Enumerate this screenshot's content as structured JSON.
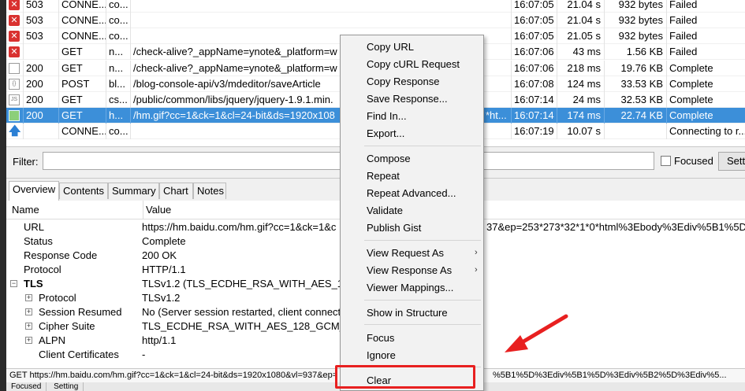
{
  "sessions": [
    {
      "icon": "error-icon",
      "result": "503",
      "protocol": "CONNE...",
      "host": "co...",
      "url": "",
      "time": "16:07:05",
      "duration": "21.04 s",
      "size": "932 bytes",
      "status": "Failed"
    },
    {
      "icon": "error-icon",
      "result": "503",
      "protocol": "CONNE...",
      "host": "co...",
      "url": "",
      "time": "16:07:05",
      "duration": "21.04 s",
      "size": "932 bytes",
      "status": "Failed"
    },
    {
      "icon": "error-icon",
      "result": "503",
      "protocol": "CONNE...",
      "host": "co...",
      "url": "",
      "time": "16:07:05",
      "duration": "21.05 s",
      "size": "932 bytes",
      "status": "Failed"
    },
    {
      "icon": "error-icon",
      "result": "",
      "protocol": "GET",
      "host": "n...",
      "url": "/check-alive?_appName=ynote&_platform=w",
      "time": "16:07:06",
      "duration": "43 ms",
      "size": "1.56 KB",
      "status": "Failed"
    },
    {
      "icon": "document-icon",
      "result": "200",
      "protocol": "GET",
      "host": "n...",
      "url": "/check-alive?_appName=ynote&_platform=w",
      "time": "16:07:06",
      "duration": "218 ms",
      "size": "19.76 KB",
      "status": "Complete"
    },
    {
      "icon": "json-icon",
      "result": "200",
      "protocol": "POST",
      "host": "bl...",
      "url": "/blog-console-api/v3/mdeditor/saveArticle",
      "time": "16:07:08",
      "duration": "124 ms",
      "size": "33.53 KB",
      "status": "Complete"
    },
    {
      "icon": "javascript-icon",
      "result": "200",
      "protocol": "GET",
      "host": "cs...",
      "url": "/public/common/libs/jquery/jquery-1.9.1.min.",
      "time": "16:07:14",
      "duration": "24 ms",
      "size": "32.53 KB",
      "status": "Complete"
    },
    {
      "icon": "image-icon",
      "result": "200",
      "protocol": "GET",
      "host": "h...",
      "url": "/hm.gif?cc=1&ck=1&cl=24-bit&ds=1920x108",
      "url_tail": "*ht...",
      "time": "16:07:14",
      "duration": "174 ms",
      "size": "22.74 KB",
      "status": "Complete",
      "selected": true
    },
    {
      "icon": "upload-arrow-icon",
      "result": "",
      "protocol": "CONNE...",
      "host": "co...",
      "url": "",
      "time": "16:07:19",
      "duration": "10.07 s",
      "size": "",
      "status": "Connecting to r..."
    }
  ],
  "filter": {
    "label": "Filter:",
    "value": "",
    "focused_label": "Focused",
    "settings_label": "Sett"
  },
  "inspector": {
    "tabs": [
      "Overview",
      "Contents",
      "Summary",
      "Chart",
      "Notes"
    ],
    "active_tab": "Overview",
    "col_name": "Name",
    "col_value": "Value",
    "properties": [
      {
        "name": "URL",
        "value": "https://hm.baidu.com/hm.gif?cc=1&ck=1&c",
        "value_tail": "37&ep=253*273*32*1*0*html%3Ebody%3Ediv%5B1%5D%"
      },
      {
        "name": "Status",
        "value": "Complete"
      },
      {
        "name": "Response Code",
        "value": "200 OK"
      },
      {
        "name": "Protocol",
        "value": "HTTP/1.1"
      },
      {
        "name": "TLS",
        "value": "TLSv1.2 (TLS_ECDHE_RSA_WITH_AES_128_GC",
        "group": true
      },
      {
        "name": "Protocol",
        "value": "TLSv1.2",
        "child": true
      },
      {
        "name": "Session Resumed",
        "value": "No (Server session restarted, client connect",
        "child": true
      },
      {
        "name": "Cipher Suite",
        "value": "TLS_ECDHE_RSA_WITH_AES_128_GCM_SHA2",
        "child": true
      },
      {
        "name": "ALPN",
        "value": "http/1.1",
        "child": true
      },
      {
        "name": "Client Certificates",
        "value": "-",
        "child": true,
        "leaf": true
      }
    ]
  },
  "statusbar": {
    "text": "GET https://hm.baidu.com/hm.gif?cc=1&ck=1&cl=24-bit&ds=1920x1080&vl=937&ep=",
    "text_tail": "%5B1%5D%3Ediv%5B1%5D%3Ediv%5B2%5D%3Ediv%5...",
    "bottom": [
      "Focused",
      "Setting"
    ]
  },
  "context_menu": [
    {
      "label": "Copy URL"
    },
    {
      "label": "Copy cURL Request"
    },
    {
      "label": "Copy Response"
    },
    {
      "label": "Save Response..."
    },
    {
      "label": "Find In..."
    },
    {
      "label": "Export..."
    },
    {
      "label": "Compose"
    },
    {
      "label": "Repeat"
    },
    {
      "label": "Repeat Advanced..."
    },
    {
      "label": "Validate"
    },
    {
      "label": "Publish Gist"
    },
    {
      "label": "View Request As",
      "submenu": true
    },
    {
      "label": "View Response As",
      "submenu": true
    },
    {
      "label": "Viewer Mappings..."
    },
    {
      "label": "Show in Structure"
    },
    {
      "label": "Focus"
    },
    {
      "label": "Ignore"
    },
    {
      "label": "Clear",
      "highlighted": true
    }
  ],
  "colors": {
    "selection": "#3c8fd9",
    "annotation": "#e82020"
  }
}
